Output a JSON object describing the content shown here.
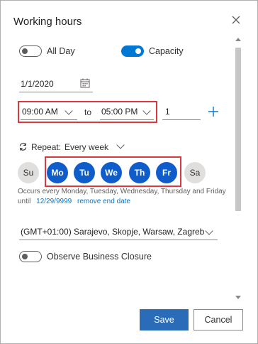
{
  "dialog": {
    "title": "Working hours"
  },
  "all_day": {
    "label": "All Day",
    "on": false
  },
  "capacity": {
    "label": "Capacity",
    "on": true
  },
  "date": {
    "value": "1/1/2020"
  },
  "time": {
    "start": "09:00 AM",
    "separator": "to",
    "end": "05:00 PM"
  },
  "capacity_value": {
    "value": "1"
  },
  "repeat": {
    "label": "Repeat:",
    "value": "Every week"
  },
  "days": [
    {
      "label": "Su",
      "selected": false
    },
    {
      "label": "Mo",
      "selected": true
    },
    {
      "label": "Tu",
      "selected": true
    },
    {
      "label": "We",
      "selected": true
    },
    {
      "label": "Th",
      "selected": true
    },
    {
      "label": "Fr",
      "selected": true
    },
    {
      "label": "Sa",
      "selected": false
    }
  ],
  "occurs": {
    "text": "Occurs every Monday, Tuesday, Wednesday, Thursday and Friday",
    "until": "until",
    "until_date": "12/29/9999",
    "remove_link": "remove end date"
  },
  "timezone": {
    "value": "(GMT+01:00) Sarajevo, Skopje, Warsaw, Zagreb"
  },
  "observe": {
    "label": "Observe Business Closure",
    "on": false
  },
  "buttons": {
    "save": "Save",
    "cancel": "Cancel"
  },
  "colors": {
    "accent": "#0078d4",
    "day_selected": "#0f5ccb",
    "highlight": "#d9383f"
  }
}
